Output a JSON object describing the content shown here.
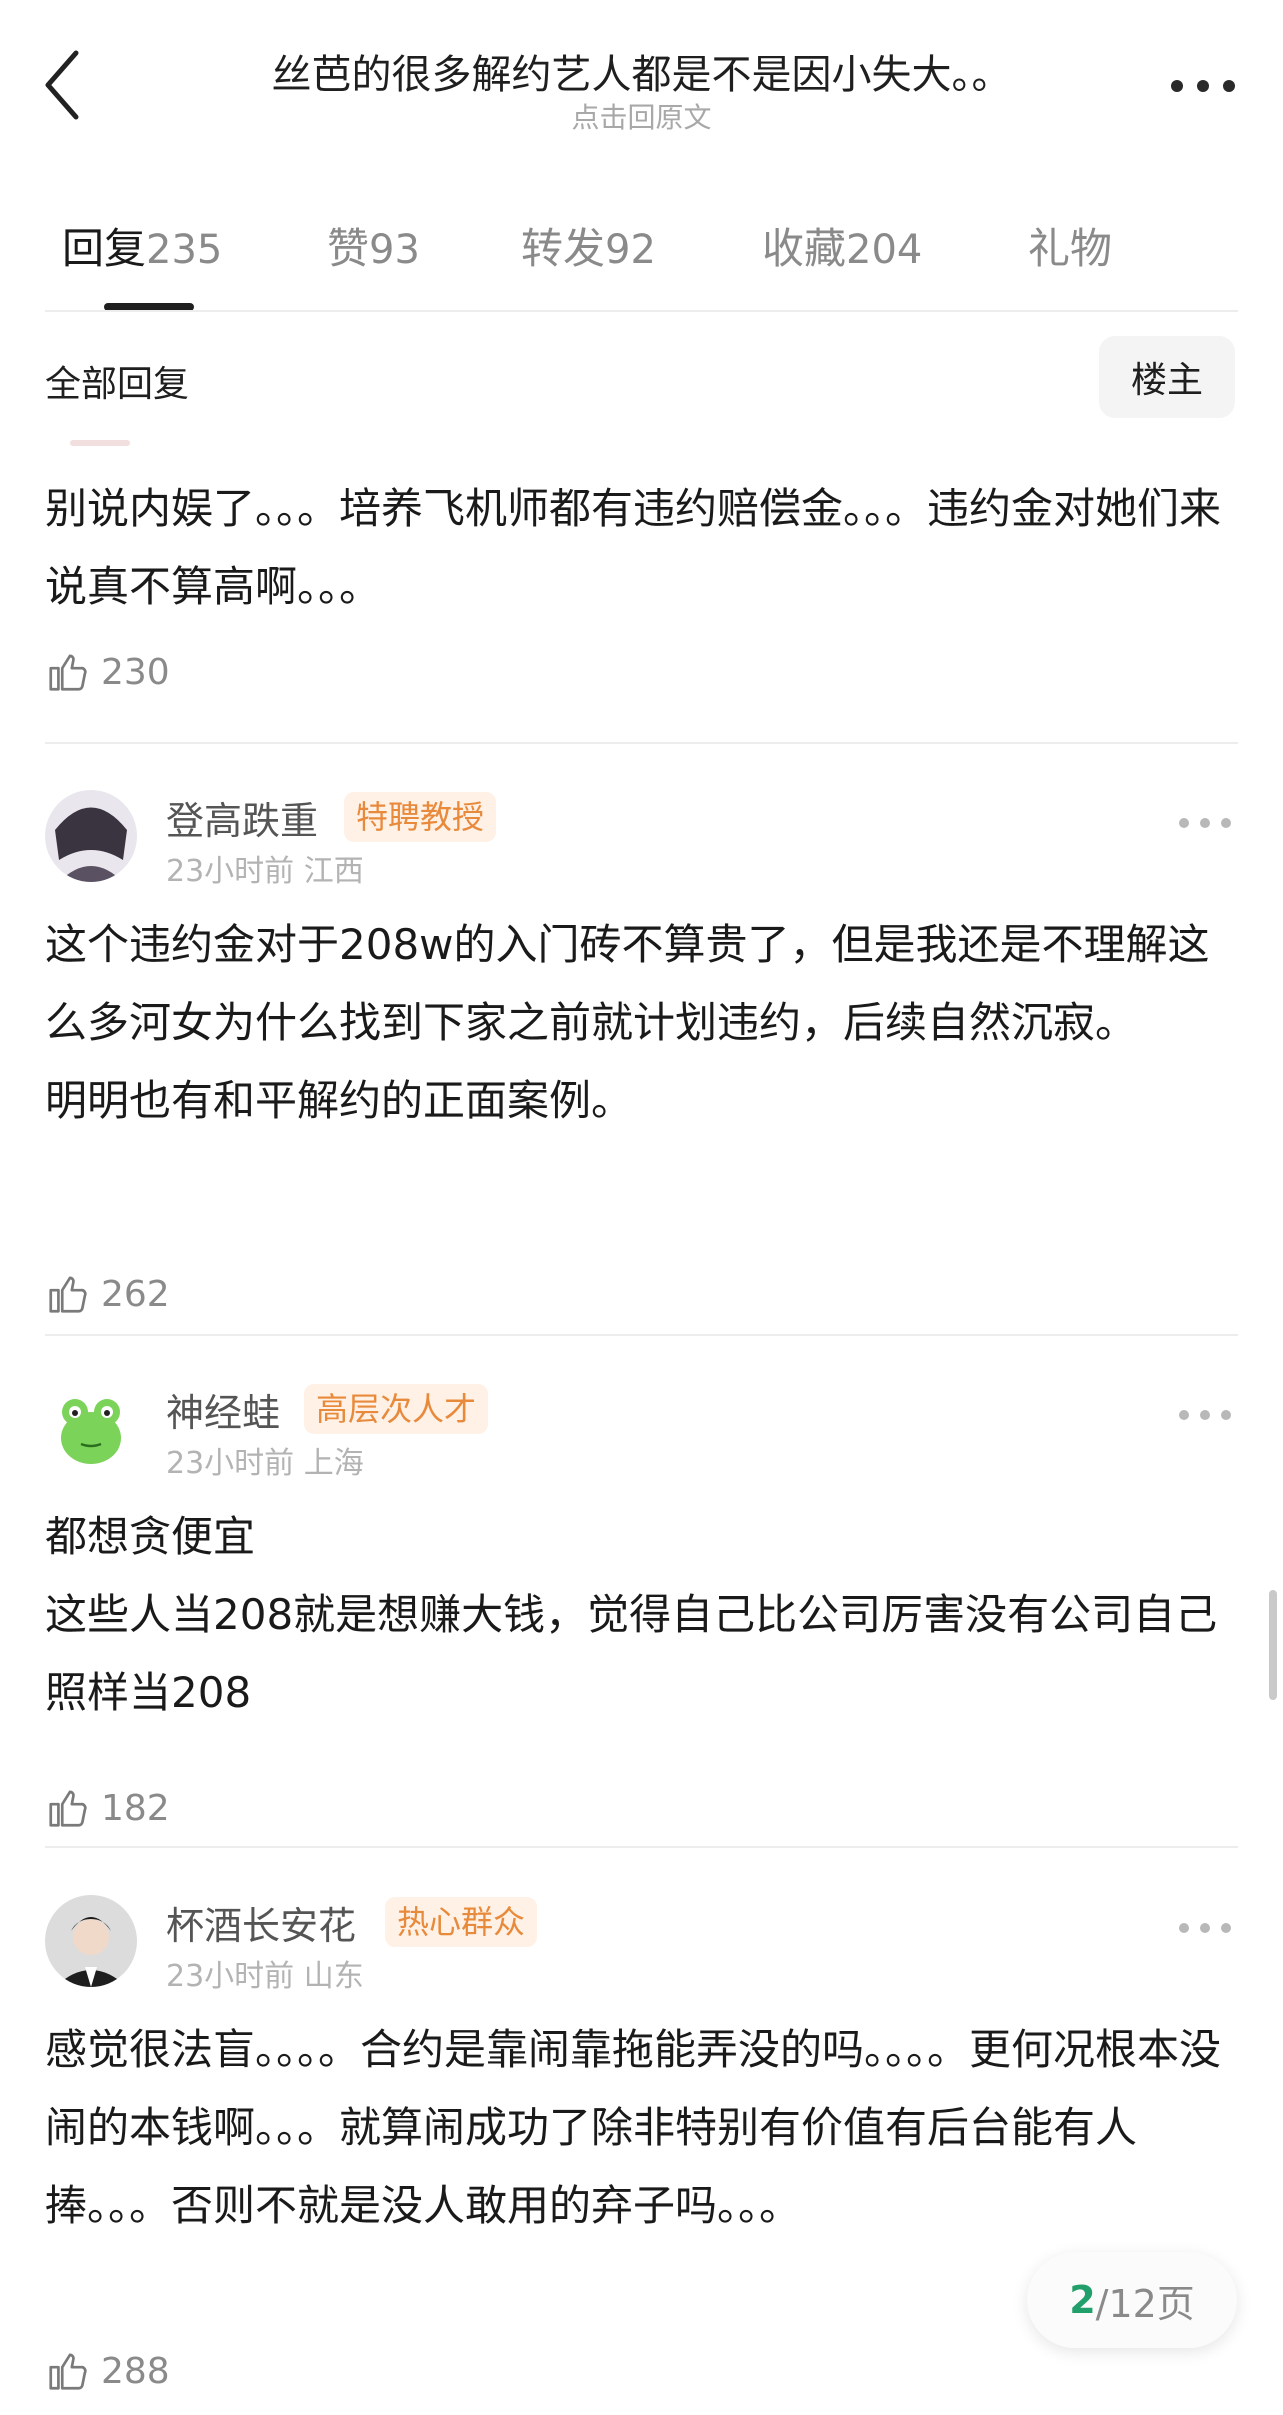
{
  "header": {
    "title": "丝芭的很多解约艺人都是不是因小失大。。",
    "subtitle": "点击回原文"
  },
  "tabs": [
    {
      "label": "回复",
      "count": "235"
    },
    {
      "label": "赞",
      "count": "93"
    },
    {
      "label": "转发",
      "count": "92"
    },
    {
      "label": "收藏",
      "count": "204"
    },
    {
      "label": "礼物",
      "count": ""
    }
  ],
  "filter": {
    "label": "全部回复",
    "op_button": "楼主"
  },
  "comments": [
    {
      "lines": [
        "别说内娱了。。。培养飞机师都有违约赔偿金。。。违约金对她们来说真不算高啊。。。"
      ],
      "likes": "230"
    },
    {
      "name": "登高跌重",
      "badge": "特聘教授",
      "time": "23小时前",
      "location": "江西",
      "lines": [
        "这个违约金对于208w的入门砖不算贵了，但是我还是不理解这么多河女为什么找到下家之前就计划违约，后续自然沉寂。",
        "明明也有和平解约的正面案例。"
      ],
      "likes": "262"
    },
    {
      "name": "神经蛙",
      "badge": "高层次人才",
      "time": "23小时前",
      "location": "上海",
      "lines": [
        "都想贪便宜",
        "这些人当208就是想赚大钱，觉得自己比公司厉害没有公司自己照样当208"
      ],
      "likes": "182"
    },
    {
      "name": "杯酒长安花",
      "badge": "热心群众",
      "time": "23小时前",
      "location": "山东",
      "lines": [
        "感觉很法盲。。。。合约是靠闹靠拖能弄没的吗。。。。更何况根本没闹的本钱啊。。。就算闹成功了除非特别有价值有后台能有人捧。。。否则不就是没人敢用的弃子吗。。。"
      ],
      "likes": "288"
    }
  ],
  "pager": {
    "current": "2",
    "total_text": "/12页"
  },
  "colors": {
    "badge_text": "#e88a3c",
    "badge_bg": "#fff1e6",
    "pager_current": "#22a06b"
  }
}
